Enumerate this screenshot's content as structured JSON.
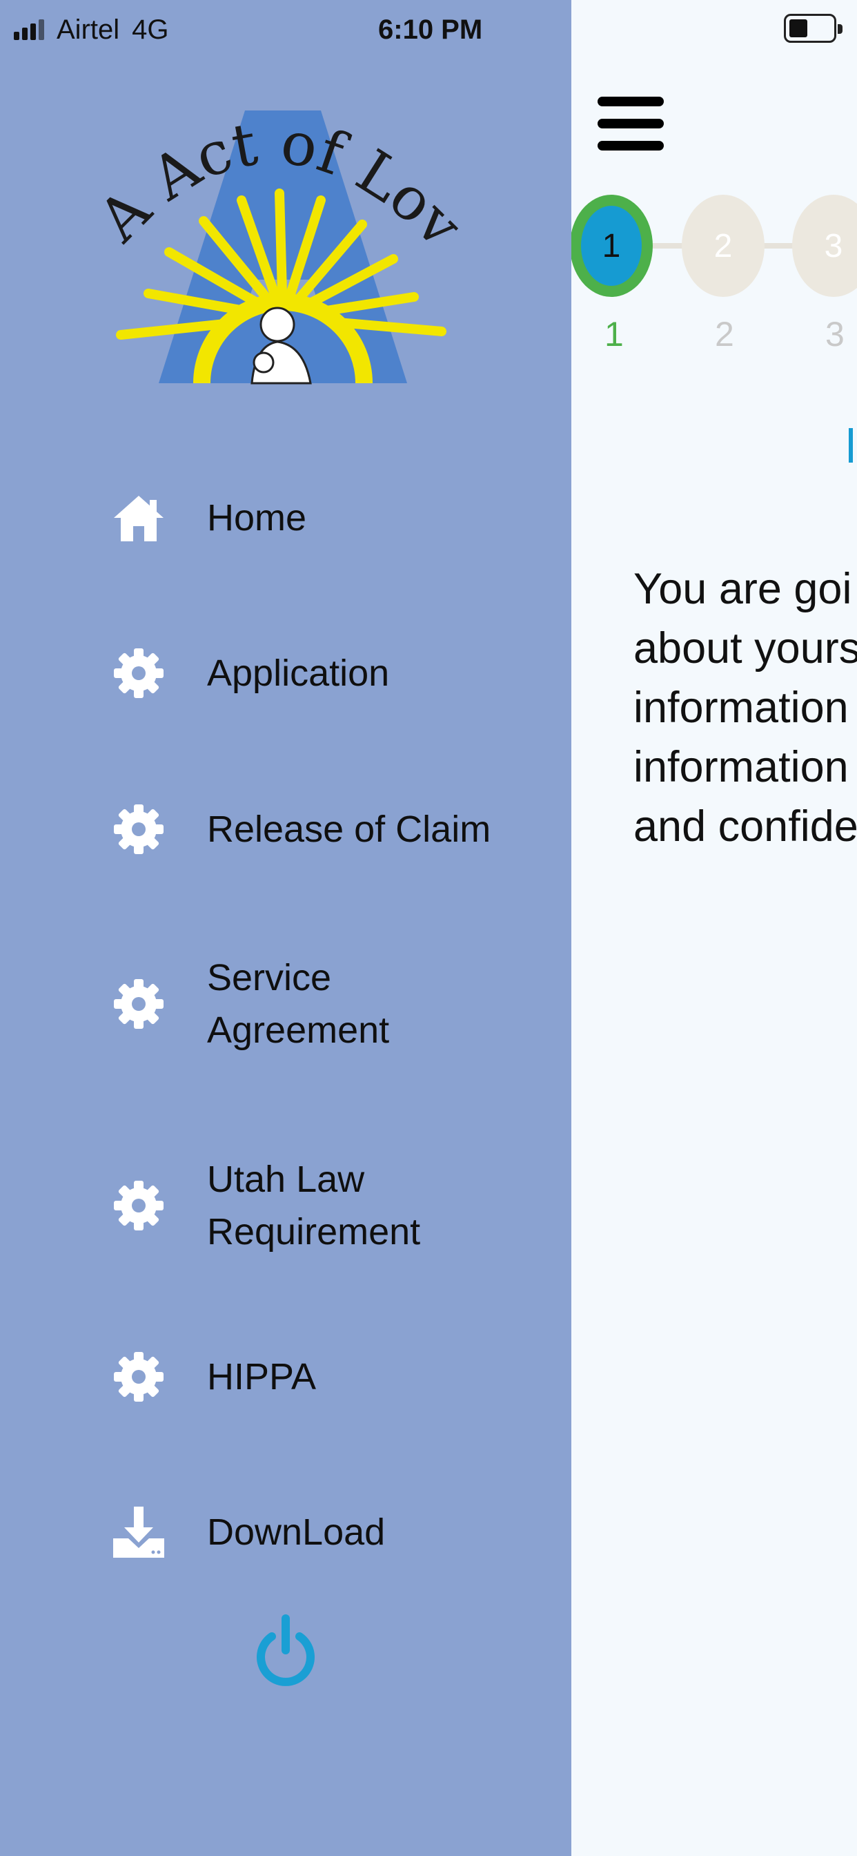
{
  "status_bar": {
    "carrier": "Airtel",
    "network": "4G",
    "time": "6:10 PM",
    "battery_level": 0.35
  },
  "logo": {
    "text": "A Act of Love",
    "icon": "sunburst-logo",
    "colors": {
      "rays": "#f2e600",
      "letter": "#4e82cc"
    }
  },
  "sidebar": {
    "background": "#8aa2d1",
    "items": [
      {
        "label": "Home",
        "icon": "home-icon"
      },
      {
        "label": "Application",
        "icon": "gear-icon"
      },
      {
        "label": "Release of Claim",
        "icon": "gear-icon"
      },
      {
        "label": "Service\nAgreement",
        "icon": "gear-icon"
      },
      {
        "label": "Utah Law\nRequirement",
        "icon": "gear-icon"
      },
      {
        "label": "HIPPA",
        "icon": "gear-icon"
      },
      {
        "label": "DownLoad",
        "icon": "download-icon"
      }
    ],
    "logout_icon": "power-icon",
    "logout_color": "#1a9fd4"
  },
  "main": {
    "steps": [
      {
        "number": "1",
        "label": "1",
        "active": true
      },
      {
        "number": "2",
        "label": "2",
        "active": false
      },
      {
        "number": "3",
        "label": "3",
        "active": false
      }
    ],
    "intro_lines": [
      "You are goi",
      "about yours",
      "information",
      "information",
      "and confider"
    ],
    "colors": {
      "active_step": "#169bd2",
      "active_ring": "#4db04a",
      "inactive_step": "#ece8df"
    }
  }
}
